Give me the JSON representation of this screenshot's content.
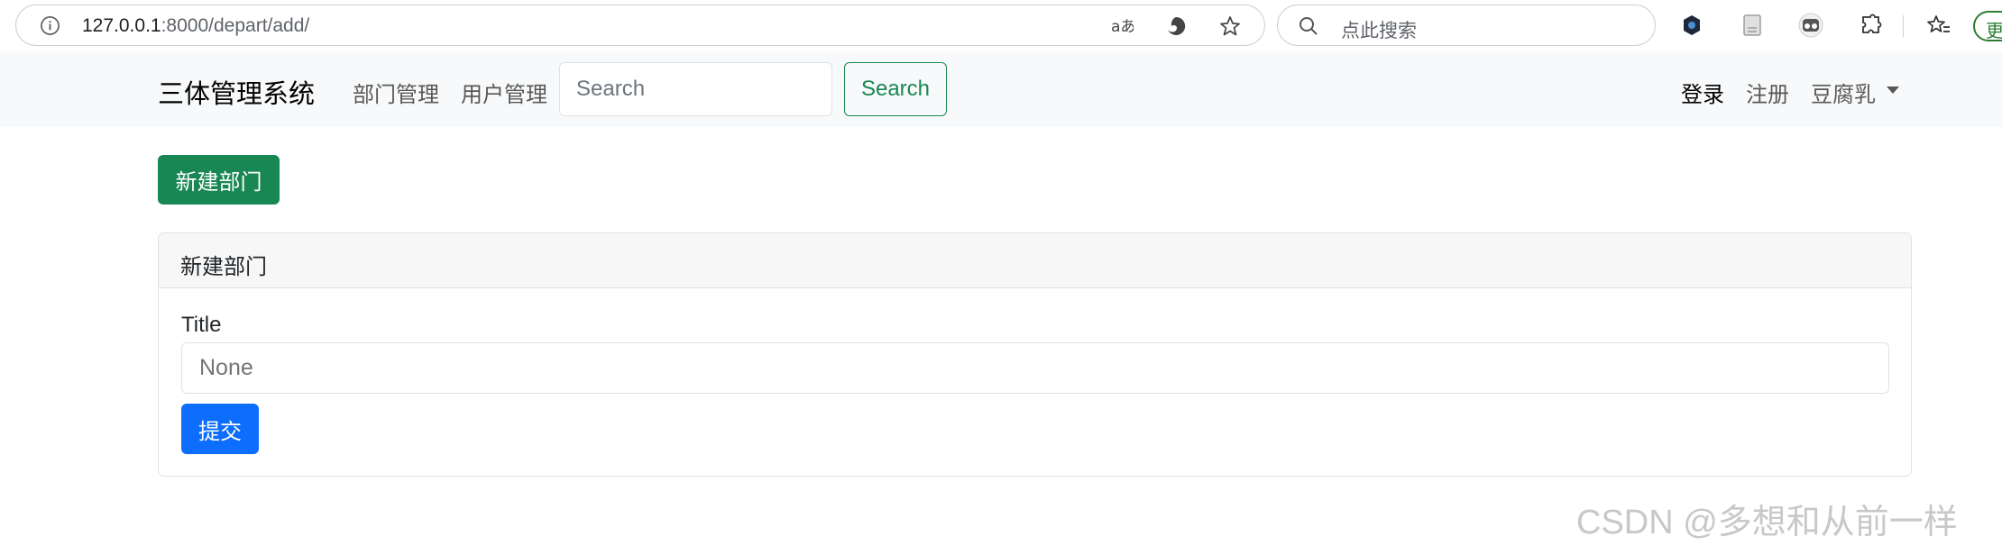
{
  "browser": {
    "url_host": "127.0.0.1",
    "url_path": ":8000/depart/add/",
    "read_aloud_icon": "read-aloud-icon",
    "search_placeholder": "点此搜索",
    "update_label": "更"
  },
  "navbar": {
    "brand": "三体管理系统",
    "links": [
      "部门管理",
      "用户管理"
    ],
    "search_placeholder": "Search",
    "search_button": "Search",
    "login": "登录",
    "register": "注册",
    "user": "豆腐乳"
  },
  "page": {
    "new_button": "新建部门",
    "card_title": "新建部门",
    "field_label": "Title",
    "field_placeholder": "None",
    "submit_button": "提交"
  },
  "watermark": "CSDN @多想和从前一样",
  "colors": {
    "success": "#198754",
    "primary": "#0d6efd",
    "navbar_bg": "#f8f9fa"
  }
}
